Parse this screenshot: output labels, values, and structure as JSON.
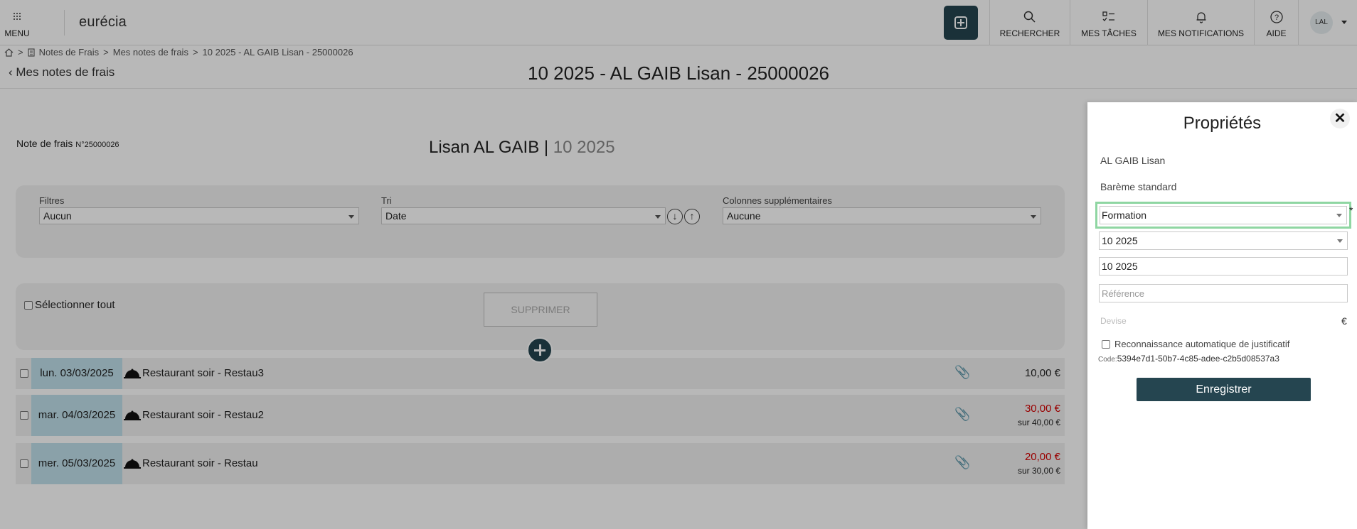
{
  "topbar": {
    "menu_label": "MENU",
    "logo_text": "eurécia",
    "search_label": "RECHERCHER",
    "tasks_label": "MES TÂCHES",
    "notifications_label": "MES NOTIFICATIONS",
    "help_label": "AIDE",
    "avatar_initials": "LAL",
    "accent_color": "#254550"
  },
  "breadcrumb": {
    "items": [
      "Notes de Frais",
      "Mes notes de frais",
      "10 2025 - AL GAIB Lisan - 25000026"
    ],
    "separator": ">"
  },
  "page": {
    "back_label": "Mes notes de frais",
    "title": "10 2025 - AL GAIB Lisan - 25000026",
    "note_label": "Note de frais ",
    "note_number": "N°25000026",
    "person_name": "Lisan AL GAIB |",
    "person_period": "10 2025"
  },
  "filters": {
    "filtres_label": "Filtres",
    "filtres_value": "Aucun",
    "tri_label": "Tri",
    "tri_value": "Date",
    "sort_desc": "↓",
    "sort_asc": "↑",
    "colonnes_label": "Colonnes supplémentaires",
    "colonnes_value": "Aucune"
  },
  "actions": {
    "select_all_label": "Sélectionner tout",
    "delete_label": "SUPPRIMER"
  },
  "expenses": [
    {
      "date": "lun. 03/03/2025",
      "label": "Restaurant soir  -  Restau3",
      "amount": "10,00 €",
      "amount_red": false,
      "sub": ""
    },
    {
      "date": "mar. 04/03/2025",
      "label": "Restaurant soir  -  Restau2",
      "amount": "30,00 €",
      "amount_red": true,
      "sub": "sur 40,00 €"
    },
    {
      "date": "mer. 05/03/2025",
      "label": "Restaurant soir  -  Restau",
      "amount": "20,00 €",
      "amount_red": true,
      "sub": "sur 30,00 €"
    }
  ],
  "panel": {
    "title": "Propriétés",
    "close_symbol": "✕",
    "employee": "AL GAIB Lisan",
    "bareme": "Barème standard",
    "type_value": "Formation",
    "required_mark": "*",
    "period_select": "10 2025",
    "period_input": "10 2025",
    "reference_placeholder": "Référence",
    "devise_label": "Devise",
    "devise_symbol": "€",
    "auto_recognition_label": "Reconnaissance automatique de justificatif",
    "code_label": "Code:",
    "code_value": "5394e7d1-50b7-4c85-adee-c2b5d08537a3",
    "save_label": "Enregistrer"
  }
}
